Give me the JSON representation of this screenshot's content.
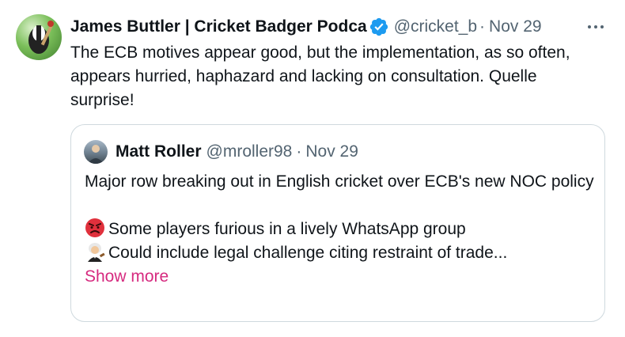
{
  "tweet": {
    "author_name": "James Buttler | Cricket Badger Podca",
    "handle": "@cricket_b",
    "separator": "·",
    "date": "Nov 29",
    "text": "The ECB motives appear good, but the implementation, as so often, appears hurried, haphazard and lacking on consultation. Quelle surprise!"
  },
  "quote": {
    "author_name": "Matt Roller",
    "handle": "@mroller98",
    "separator": "·",
    "date": "Nov 29",
    "line1": "Major row breaking out in English cricket over ECB's new NOC policy",
    "line2": "Some players furious in a lively WhatsApp group",
    "line3": "Could include legal challenge citing restraint of trade...",
    "show_more": "Show more"
  },
  "icons": {
    "verified": "verified-badge-icon",
    "more": "more-options-icon",
    "angry": "angry-face-emoji",
    "judge": "judge-emoji"
  },
  "colors": {
    "verified": "#1d9bf0",
    "secondary_text": "#536471",
    "show_more": "#d62a7f",
    "border": "#cfd9de"
  }
}
